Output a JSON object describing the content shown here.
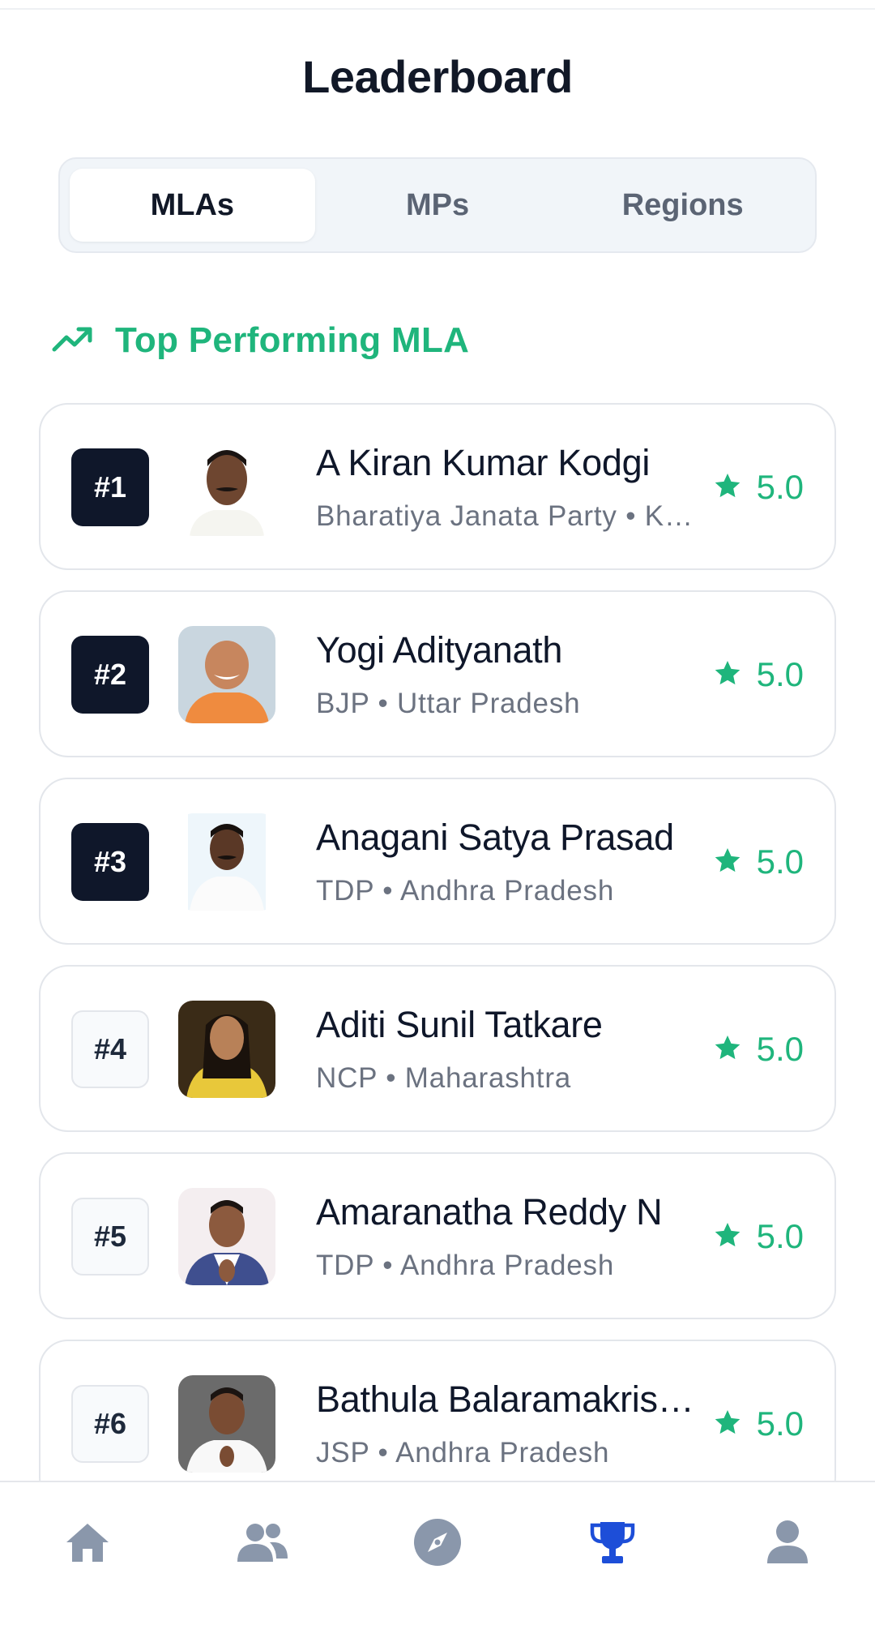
{
  "header": {
    "title": "Leaderboard"
  },
  "tabs": [
    {
      "label": "MLAs",
      "active": true
    },
    {
      "label": "MPs",
      "active": false
    },
    {
      "label": "Regions",
      "active": false
    }
  ],
  "section": {
    "title": "Top Performing MLA",
    "icon": "trending-up-icon"
  },
  "entries": [
    {
      "rank": "#1",
      "name": "A Kiran Kumar Kodgi",
      "subtitle": "Bharatiya Janata Party • Karnataka",
      "rating": "5.0",
      "highlight": true
    },
    {
      "rank": "#2",
      "name": "Yogi Adityanath",
      "subtitle": "BJP • Uttar Pradesh",
      "rating": "5.0",
      "highlight": true
    },
    {
      "rank": "#3",
      "name": "Anagani Satya Prasad",
      "subtitle": "TDP • Andhra Pradesh",
      "rating": "5.0",
      "highlight": true
    },
    {
      "rank": "#4",
      "name": "Aditi Sunil Tatkare",
      "subtitle": "NCP • Maharashtra",
      "rating": "5.0",
      "highlight": false
    },
    {
      "rank": "#5",
      "name": "Amaranatha Reddy N",
      "subtitle": "TDP • Andhra Pradesh",
      "rating": "5.0",
      "highlight": false
    },
    {
      "rank": "#6",
      "name": "Bathula Balaramakrishna",
      "subtitle": "JSP • Andhra Pradesh",
      "rating": "5.0",
      "highlight": false
    }
  ],
  "bottom_nav": [
    {
      "icon": "home-icon",
      "active": false
    },
    {
      "icon": "users-icon",
      "active": false
    },
    {
      "icon": "compass-icon",
      "active": false
    },
    {
      "icon": "trophy-icon",
      "active": true
    },
    {
      "icon": "profile-icon",
      "active": false
    }
  ],
  "colors": {
    "accent": "#1fb57c",
    "active_nav": "#1d4ed8",
    "inactive_nav": "#8a97ab",
    "rank_dark": "#0f172a"
  }
}
